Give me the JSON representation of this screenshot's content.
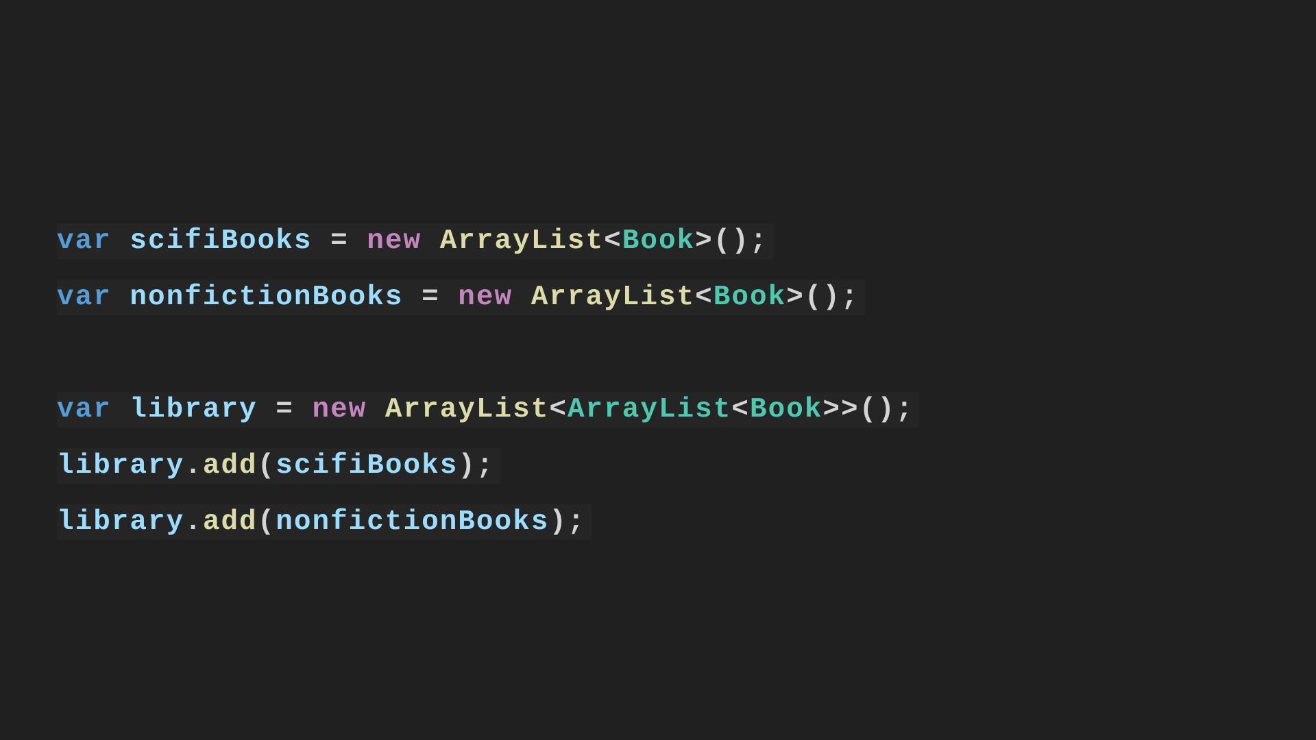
{
  "colors": {
    "background": "#202020",
    "line_highlight": "#252525",
    "keyword": "#569cd6",
    "variable": "#9cdcfe",
    "operator": "#d4d4d4",
    "new_keyword": "#c586c0",
    "class_name": "#dcdcaa",
    "type_param": "#4ec9b0",
    "method": "#dcdcaa",
    "punct": "#d4d4d4"
  },
  "lines": [
    {
      "tokens": [
        {
          "text": "var",
          "kind": "keyword"
        },
        {
          "text": " ",
          "kind": "punct"
        },
        {
          "text": "scifiBooks",
          "kind": "variable"
        },
        {
          "text": " = ",
          "kind": "operator"
        },
        {
          "text": "new",
          "kind": "new_keyword"
        },
        {
          "text": " ",
          "kind": "punct"
        },
        {
          "text": "ArrayList",
          "kind": "class_name"
        },
        {
          "text": "<",
          "kind": "punct"
        },
        {
          "text": "Book",
          "kind": "type_param"
        },
        {
          "text": ">",
          "kind": "punct"
        },
        {
          "text": "();",
          "kind": "punct"
        }
      ]
    },
    {
      "tokens": [
        {
          "text": "var",
          "kind": "keyword"
        },
        {
          "text": " ",
          "kind": "punct"
        },
        {
          "text": "nonfictionBooks",
          "kind": "variable"
        },
        {
          "text": " = ",
          "kind": "operator"
        },
        {
          "text": "new",
          "kind": "new_keyword"
        },
        {
          "text": " ",
          "kind": "punct"
        },
        {
          "text": "ArrayList",
          "kind": "class_name"
        },
        {
          "text": "<",
          "kind": "punct"
        },
        {
          "text": "Book",
          "kind": "type_param"
        },
        {
          "text": ">",
          "kind": "punct"
        },
        {
          "text": "();",
          "kind": "punct"
        }
      ]
    },
    {
      "tokens": []
    },
    {
      "tokens": [
        {
          "text": "var",
          "kind": "keyword"
        },
        {
          "text": " ",
          "kind": "punct"
        },
        {
          "text": "library",
          "kind": "variable"
        },
        {
          "text": " = ",
          "kind": "operator"
        },
        {
          "text": "new",
          "kind": "new_keyword"
        },
        {
          "text": " ",
          "kind": "punct"
        },
        {
          "text": "ArrayList",
          "kind": "class_name"
        },
        {
          "text": "<",
          "kind": "punct"
        },
        {
          "text": "ArrayList",
          "kind": "type_param"
        },
        {
          "text": "<",
          "kind": "punct"
        },
        {
          "text": "Book",
          "kind": "type_param"
        },
        {
          "text": ">>",
          "kind": "punct"
        },
        {
          "text": "();",
          "kind": "punct"
        }
      ]
    },
    {
      "tokens": [
        {
          "text": "library",
          "kind": "variable"
        },
        {
          "text": ".",
          "kind": "punct"
        },
        {
          "text": "add",
          "kind": "method"
        },
        {
          "text": "(",
          "kind": "punct"
        },
        {
          "text": "scifiBooks",
          "kind": "variable"
        },
        {
          "text": ");",
          "kind": "punct"
        }
      ]
    },
    {
      "tokens": [
        {
          "text": "library",
          "kind": "variable"
        },
        {
          "text": ".",
          "kind": "punct"
        },
        {
          "text": "add",
          "kind": "method"
        },
        {
          "text": "(",
          "kind": "punct"
        },
        {
          "text": "nonfictionBooks",
          "kind": "variable"
        },
        {
          "text": ");",
          "kind": "punct"
        }
      ]
    }
  ]
}
